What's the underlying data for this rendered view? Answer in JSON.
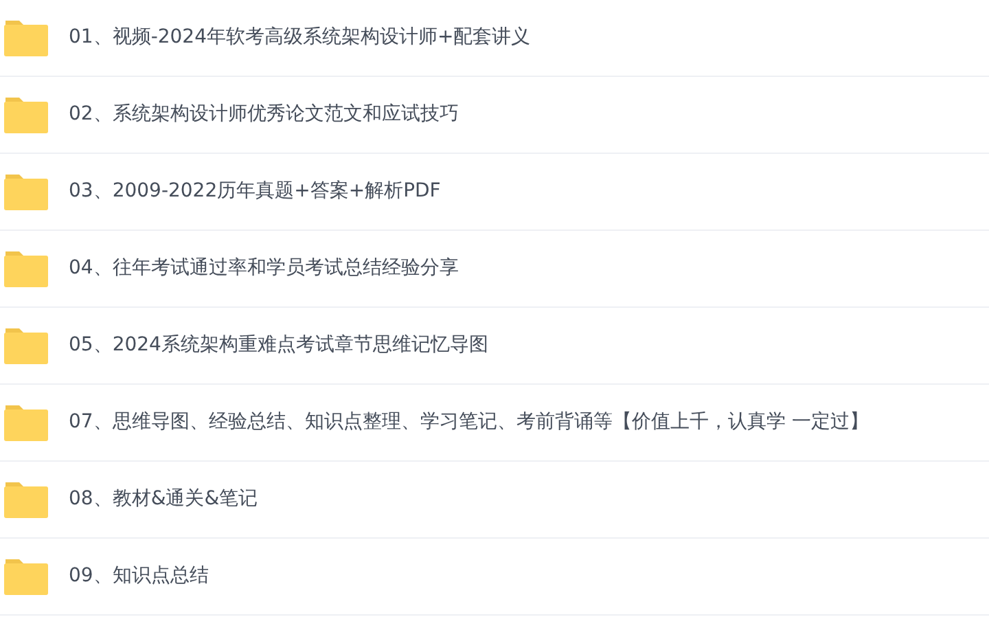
{
  "folders": [
    {
      "name": "01、视频-2024年软考高级系统架构设计师+配套讲义"
    },
    {
      "name": "02、系统架构设计师优秀论文范文和应试技巧"
    },
    {
      "name": "03、2009-2022历年真题+答案+解析PDF"
    },
    {
      "name": "04、往年考试通过率和学员考试总结经验分享"
    },
    {
      "name": "05、2024系统架构重难点考试章节思维记忆导图"
    },
    {
      "name": "07、思维导图、经验总结、知识点整理、学习笔记、考前背诵等【价值上千，认真学 一定过】"
    },
    {
      "name": "08、教材&通关&笔记"
    },
    {
      "name": "09、知识点总结"
    }
  ]
}
